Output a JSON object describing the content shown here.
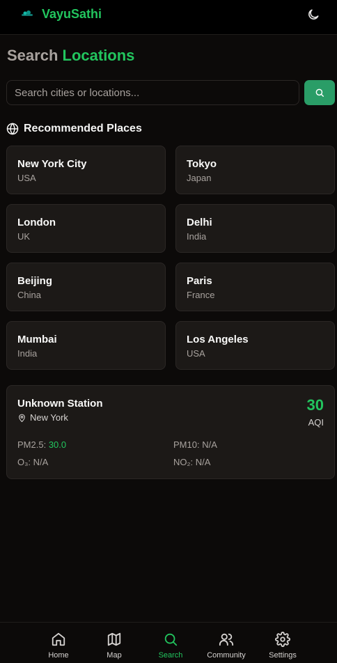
{
  "app": {
    "brand": "VayuSathi",
    "logo_icon": "logo-icon",
    "theme_icon": "moon-icon"
  },
  "page": {
    "title_part1": "Search",
    "title_part2": "Locations"
  },
  "search": {
    "placeholder": "Search cities or locations...",
    "value": "",
    "button_icon": "search-icon"
  },
  "recommended": {
    "heading": "Recommended Places",
    "icon": "globe-icon",
    "places": [
      {
        "city": "New York City",
        "country": "USA"
      },
      {
        "city": "Tokyo",
        "country": "Japan"
      },
      {
        "city": "London",
        "country": "UK"
      },
      {
        "city": "Delhi",
        "country": "India"
      },
      {
        "city": "Beijing",
        "country": "China"
      },
      {
        "city": "Paris",
        "country": "France"
      },
      {
        "city": "Mumbai",
        "country": "India"
      },
      {
        "city": "Los Angeles",
        "country": "USA"
      }
    ]
  },
  "station": {
    "name": "Unknown Station",
    "location": "New York",
    "location_icon": "map-pin-icon",
    "aqi": "30",
    "aqi_label": "AQI",
    "pm25_label": "PM2.5:",
    "pm25": "30.0",
    "pm10_label": "PM10:",
    "pm10": "N/A",
    "o3_label": "O₃:",
    "o3": "N/A",
    "no2_label": "NO₂:",
    "no2": "N/A"
  },
  "nav": {
    "items": [
      {
        "label": "Home",
        "icon": "home-icon"
      },
      {
        "label": "Map",
        "icon": "map-icon"
      },
      {
        "label": "Search",
        "icon": "search-icon",
        "active": true
      },
      {
        "label": "Community",
        "icon": "users-icon"
      },
      {
        "label": "Settings",
        "icon": "gear-icon"
      }
    ]
  },
  "colors": {
    "background": "#0c0a09",
    "card": "#1c1917",
    "accent": "#22c55e",
    "button": "#2a9d67",
    "muted": "#a8a29e"
  }
}
